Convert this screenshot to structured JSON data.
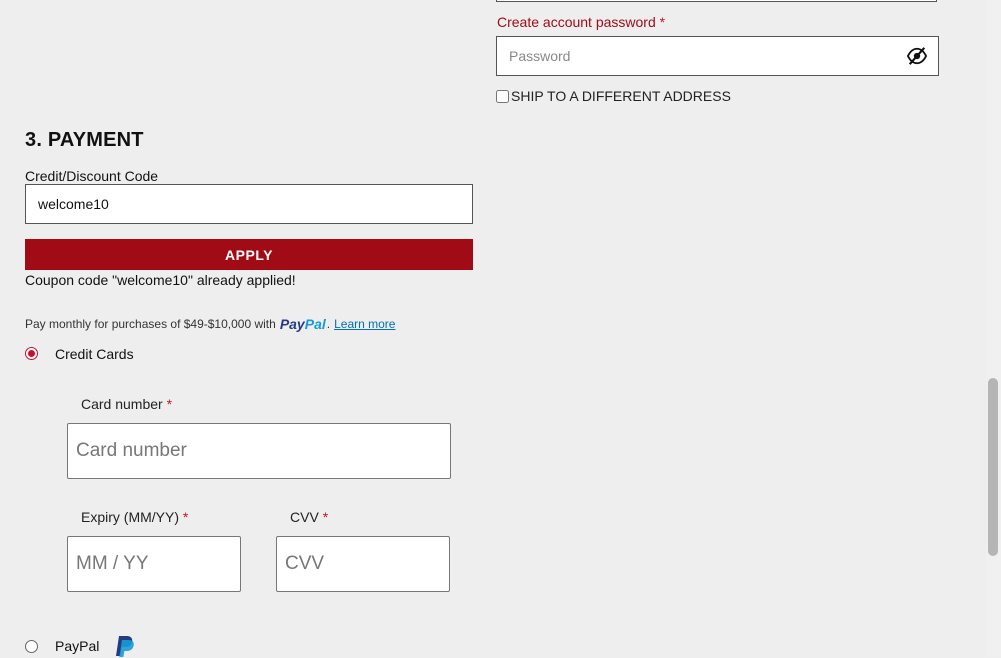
{
  "account": {
    "password_label": "Create account password",
    "required_mark": "*",
    "password_placeholder": "Password",
    "toggle_icon": "eye-slash-icon",
    "ship_different_label": "SHIP TO A DIFFERENT ADDRESS",
    "ship_different_checked": false
  },
  "payment": {
    "section_title": "3. PAYMENT",
    "code_label": "Credit/Discount Code",
    "code_value": "welcome10",
    "apply_label": "APPLY",
    "coupon_message": "Coupon code \"welcome10\" already applied!",
    "paypal_message": {
      "text": "Pay monthly for purchases of $49-$10,000 with",
      "logo_pay": "Pay",
      "logo_pal": "Pal",
      "period": ".",
      "learn_more": "Learn more"
    },
    "methods": [
      {
        "label": "Credit Cards",
        "selected": true
      },
      {
        "label": "PayPal",
        "selected": false,
        "icon": "paypal-icon"
      }
    ],
    "card": {
      "number_label": "Card number",
      "number_placeholder": "Card number",
      "expiry_label": "Expiry (MM/YY)",
      "expiry_placeholder": "MM / YY",
      "cvv_label": "CVV",
      "cvv_placeholder": "CVV"
    }
  },
  "colors": {
    "brand": "#a10b16",
    "required": "#c8102e",
    "background": "#eeeeee",
    "paypal_dark": "#253b80",
    "paypal_light": "#179bd7"
  }
}
